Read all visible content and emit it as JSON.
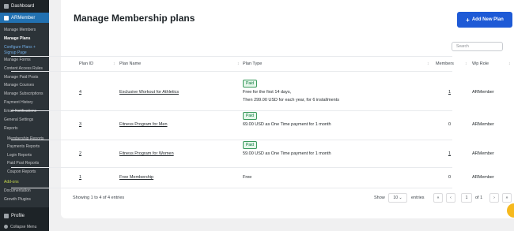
{
  "sidebar": {
    "dashboard": "Dashboard",
    "armember": "ARMember",
    "items": [
      {
        "label": "Manage Members",
        "cls": ""
      },
      {
        "label": "Manage Plans",
        "cls": "current"
      },
      {
        "label": "Configure Plans +",
        "cls": "highlight"
      },
      {
        "label": "Signup Page",
        "cls": "highlight"
      },
      {
        "label": "Manage Forms",
        "cls": ""
      },
      {
        "label": "Content Access Rules",
        "cls": ""
      },
      {
        "label": "Manage Paid Posts",
        "cls": ""
      },
      {
        "label": "Manage Courses",
        "cls": ""
      },
      {
        "label": "Manage Subscriptions",
        "cls": ""
      },
      {
        "label": "Payment History",
        "cls": ""
      },
      {
        "label": "Email Notifications",
        "cls": ""
      },
      {
        "label": "General Settings",
        "cls": ""
      },
      {
        "label": "Reports",
        "cls": ""
      },
      {
        "label": "Membership Reports",
        "cls": "indent"
      },
      {
        "label": "Payments Reports",
        "cls": "indent"
      },
      {
        "label": "Login Reports",
        "cls": "indent"
      },
      {
        "label": "Paid Post Reports",
        "cls": "indent"
      },
      {
        "label": "Coupon Reports",
        "cls": "indent"
      },
      {
        "label": "Add-ons",
        "cls": "addons"
      },
      {
        "label": "Documentation",
        "cls": ""
      },
      {
        "label": "Growth Plugins",
        "cls": ""
      }
    ],
    "profile": "Profile",
    "collapse": "Collapse Menu"
  },
  "main": {
    "title": "Manage Membership plans",
    "add_button": "Add New Plan",
    "search_placeholder": "Search",
    "columns": [
      "Plan ID",
      "Plan Name",
      "Plan Type",
      "Members",
      "Wp Role"
    ],
    "rows": [
      {
        "id": "4",
        "name": "Exclusive Workout for Athletics",
        "badge": "Paid",
        "type_lines": [
          "Free for the first 14 days,",
          "Then 299.00 USD for each year, for 6 installments"
        ],
        "members": "1",
        "role": "ARMember"
      },
      {
        "id": "3",
        "name": "Fitness Program for Men",
        "badge": "Paid",
        "type_lines": [
          "69.00 USD as One Time payment for 1 month"
        ],
        "members": "0",
        "role": "ARMember"
      },
      {
        "id": "2",
        "name": "Fitness Program for Women",
        "badge": "Paid",
        "type_lines": [
          "59.00 USD as One Time payment for 1 month"
        ],
        "members": "1",
        "role": "ARMember"
      },
      {
        "id": "1",
        "name": "Free Membership",
        "badge": "",
        "type_lines": [
          "Free"
        ],
        "members": "0",
        "role": "ARMember"
      }
    ],
    "footer": {
      "showing": "Showing 1 to 4 of 4 entries",
      "show_label": "Show",
      "page_size": "10",
      "entries_label": "entries",
      "current_page": "1",
      "of_label": "of 1"
    }
  },
  "colors": {
    "accent": "#1e5ad6",
    "sidebar": "#1d2327",
    "active_menu": "#2271b1"
  }
}
